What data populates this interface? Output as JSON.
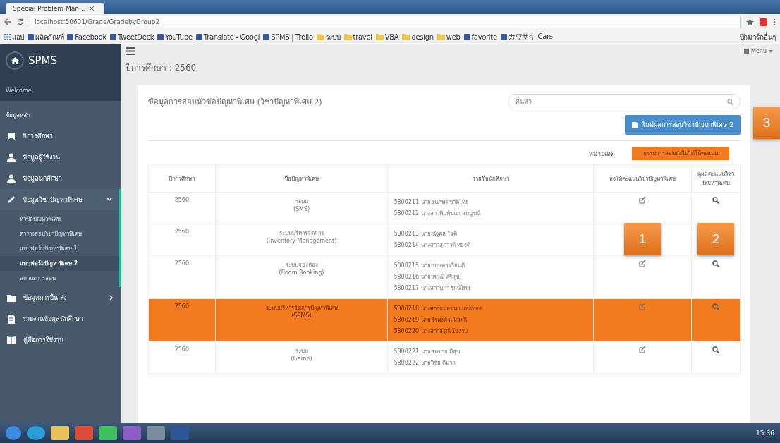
{
  "browser": {
    "tab_title": "Special Problem Man...",
    "url": "localhost:50601/Grade/GradebyGroup2",
    "bookmarks": [
      {
        "label": "แอป",
        "kind": "apps"
      },
      {
        "label": "ผลิตภัณฑ์",
        "kind": "site"
      },
      {
        "label": "Facebook",
        "kind": "site"
      },
      {
        "label": "TweetDeck",
        "kind": "site"
      },
      {
        "label": "YouTube",
        "kind": "site"
      },
      {
        "label": "Translate - Googl",
        "kind": "site"
      },
      {
        "label": "SPMS | Trello",
        "kind": "site"
      },
      {
        "label": "ระบบ",
        "kind": "folder"
      },
      {
        "label": "travel",
        "kind": "folder"
      },
      {
        "label": "VBA",
        "kind": "folder"
      },
      {
        "label": "design",
        "kind": "folder"
      },
      {
        "label": "web",
        "kind": "folder"
      },
      {
        "label": "favorite",
        "kind": "site"
      },
      {
        "label": "カワサキ Cars",
        "kind": "site"
      }
    ],
    "other_bookmarks": "บุ๊กมาร์กอื่นๆ"
  },
  "sidebar": {
    "brand": "SPMS",
    "welcome": "Welcome",
    "section": "ข้อมูลหลัก",
    "items": [
      {
        "label": "ปีการศึกษา",
        "kind": "link",
        "expanded": false
      },
      {
        "label": "ข้อมูลผู้ใช้งาน",
        "kind": "link",
        "expanded": false
      },
      {
        "label": "ข้อมูลนักศึกษา",
        "kind": "link",
        "expanded": false
      },
      {
        "label": "ข้อมูลวิชาปัญหาพิเศษ",
        "kind": "group",
        "expanded": true,
        "children": [
          {
            "label": "หัวข้อปัญหาพิเศษ",
            "selected": false
          },
          {
            "label": "ตารางสอบวิชาปัญหาพิเศษ",
            "selected": false
          },
          {
            "label": "แบบฟอร์มปัญหาพิเศษ 1",
            "selected": false
          },
          {
            "label": "แบบฟอร์มปัญหาพิเศษ 2",
            "selected": true
          },
          {
            "label": "สถานะการสอบ",
            "selected": false
          }
        ]
      },
      {
        "label": "ข้อมูลการยื่น-ส่ง",
        "kind": "group",
        "expanded": false
      },
      {
        "label": "รายงานข้อมูลนักศึกษา",
        "kind": "link",
        "expanded": false
      },
      {
        "label": "คู่มือการใช้งาน",
        "kind": "link",
        "expanded": false
      }
    ]
  },
  "header": {
    "year_label": "ปีการศึกษา : 2560",
    "menu_label": "Menu"
  },
  "panel": {
    "title": "ข้อมูลการสอบหัวข้อปัญหาพิเศษ (วิชาปัญหาพิเศษ 2)",
    "search": {
      "placeholder": "ค้นหา"
    },
    "print_button": "พิมพ์ผลการสอบวิชาปัญหาพิเศษ 2",
    "legend_label": "หมายเหตุ",
    "legend_text": "กรรมการสอบยังไม่ได้ให้คะแนน",
    "table": {
      "columns": [
        "ปีการศึกษา",
        "ชื่อปัญหาพิเศษ",
        "รายชื่อนักศึกษา",
        "ลงให้คะแนนวิชาปัญหาพิเศษ",
        "ดูผลคะแนนวิชาปัญหาพิเศษ"
      ],
      "rows": [
        {
          "year": "2560",
          "title": [
            "ระบบ",
            "(SMS)"
          ],
          "students": [
            "5800211 นายธนภัทร ชาติไทย",
            "5800212 นางสาวพิมพ์ชนก สมบูรณ์"
          ],
          "pending": false
        },
        {
          "year": "2560",
          "title": [
            "ระบบบริหารจัดการ",
            "(Inventory Management)"
          ],
          "students": [
            "5800213 นายณัฐพล ใจดี",
            "5800214 นางสาวสุภาวดี ทองดี"
          ],
          "pending": false
        },
        {
          "year": "2560",
          "title": [
            "ระบบจองห้อง",
            "(Room Booking)"
          ],
          "students": [
            "5800215 นายกฤษดา เรียนดี",
            "5800216 นายวรวุฒิ ศรีสุข",
            "5800217 นางสาวนภา รักษ์ไทย"
          ],
          "pending": false
        },
        {
          "year": "2560",
          "title": [
            "ระบบบริหารจัดการปัญหาพิเศษ",
            "(SPMS)"
          ],
          "students": [
            "5800218 นางสาวกมลชนก แสงทอง",
            "5800219 นายธีรพงศ์ แก้วมณี",
            "5800220 นางสาวอรุณี ใจงาม"
          ],
          "pending": true
        },
        {
          "year": "2560",
          "title": [
            "ระบบ",
            "(Game)"
          ],
          "students": [
            "5800221 นายสมชาย มีสุข",
            "5800222 นายวิชัย ดีมาก"
          ],
          "pending": false
        }
      ]
    }
  },
  "callouts": [
    {
      "number": "1"
    },
    {
      "number": "2"
    },
    {
      "number": "3"
    }
  ],
  "taskbar": {
    "apps": [
      {
        "kind": "start"
      },
      {
        "kind": "browser"
      },
      {
        "kind": "folder"
      },
      {
        "kind": "chrome"
      },
      {
        "kind": "chat"
      },
      {
        "kind": "studio"
      },
      {
        "kind": "photo"
      },
      {
        "kind": "word"
      }
    ],
    "clock": "15:36"
  }
}
